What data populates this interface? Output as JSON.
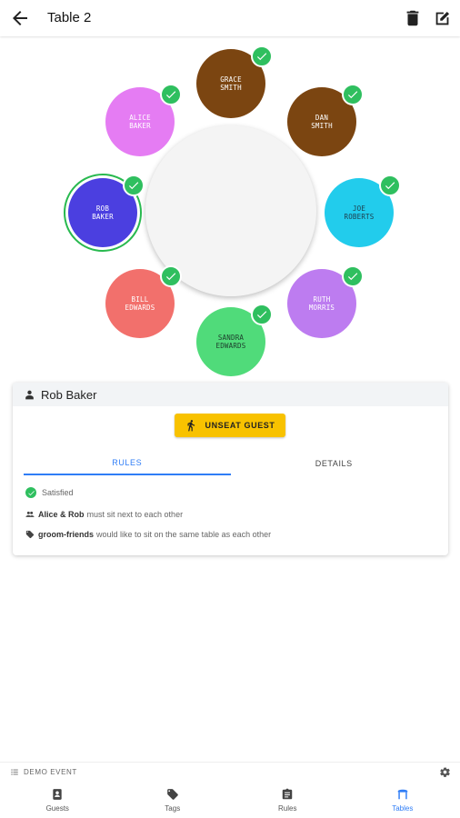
{
  "header": {
    "title": "Table 2"
  },
  "seats": [
    {
      "name": "GRACE\nSMITH",
      "color": "#7b4511",
      "text_color": "#ffffff"
    },
    {
      "name": "DAN\nSMITH",
      "color": "#7b4511",
      "text_color": "#ffffff"
    },
    {
      "name": "JOE\nROBERTS",
      "color": "#22ccec",
      "text_color": "#1d3d4c"
    },
    {
      "name": "RUTH\nMORRIS",
      "color": "#bd7cf0",
      "text_color": "#ffffff"
    },
    {
      "name": "SANDRA\nEDWARDS",
      "color": "#50db7a",
      "text_color": "#1d3d2c"
    },
    {
      "name": "BILL\nEDWARDS",
      "color": "#f2706c",
      "text_color": "#ffffff"
    },
    {
      "name": "ROB\nBAKER",
      "color": "#4b3fe0",
      "text_color": "#ffffff"
    },
    {
      "name": "ALICE\nBAKER",
      "color": "#e57cf3",
      "text_color": "#ffffff"
    }
  ],
  "guest_card": {
    "guest_name": "Rob Baker",
    "unseat_label": "UNSEAT GUEST",
    "tabs": [
      "RULES",
      "DETAILS"
    ],
    "status": "Satisfied",
    "rule1": {
      "bold": "Alice & Rob",
      "text": "must sit next to each other"
    },
    "rule2": {
      "bold": "groom-friends",
      "text": "would like to sit on the same table as each other"
    }
  },
  "event": {
    "name": "DEMO EVENT"
  },
  "nav": [
    {
      "label": "Guests",
      "icon": "contact-icon"
    },
    {
      "label": "Tags",
      "icon": "tag-icon"
    },
    {
      "label": "Rules",
      "icon": "clipboard-icon"
    },
    {
      "label": "Tables",
      "icon": "table-icon"
    }
  ],
  "colors": {
    "accent": "#2f7df6",
    "check": "#2fbf5f",
    "unseat": "#f8c200"
  }
}
